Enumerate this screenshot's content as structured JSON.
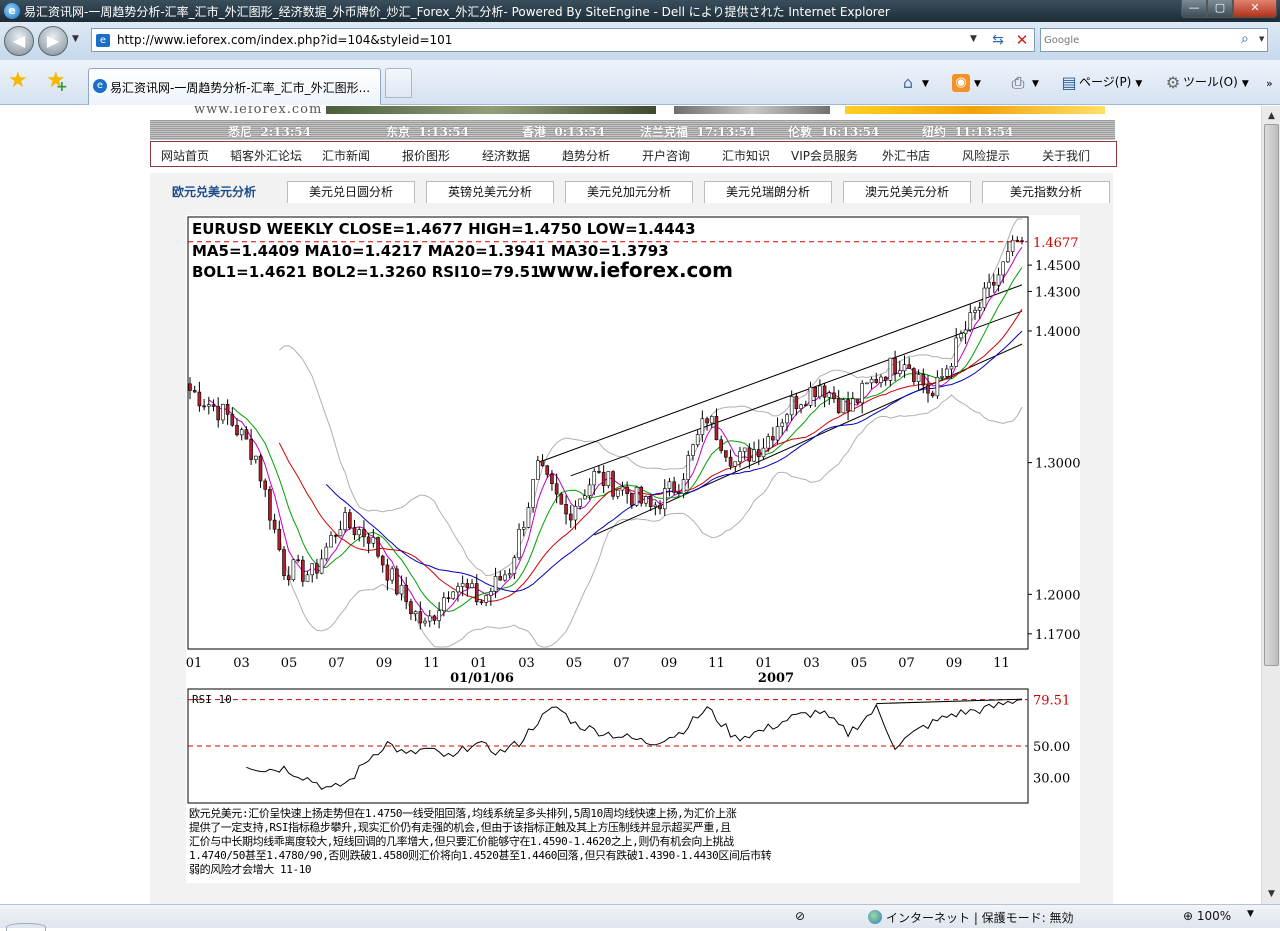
{
  "window": {
    "title": "易汇资讯网-一周趋势分析-汇率_汇市_外汇图形_经济数据_外币牌价_炒汇_Forex_外汇分析- Powered By SiteEngine - Dell により提供された Internet Explorer",
    "min_symbol": "—",
    "max_symbol": "▢",
    "close_symbol": "✕"
  },
  "address": {
    "url": "http://www.ieforex.com/index.php?id=104&styleid=101",
    "search_placeholder": "Google"
  },
  "tabs": [
    {
      "label": "易汇资讯网-一周趋势分析-汇率_汇市_外汇图形..."
    }
  ],
  "commands": {
    "page": "ページ(P)",
    "tools": "ツール(O)"
  },
  "site": {
    "logo_fragment": "www.ieforex.com",
    "clocks": [
      {
        "city": "悉尼",
        "time": "2:13:54"
      },
      {
        "city": "东京",
        "time": "1:13:54"
      },
      {
        "city": "香港",
        "time": "0:13:54"
      },
      {
        "city": "法兰克福",
        "time": "17:13:54"
      },
      {
        "city": "伦敦",
        "time": "16:13:54"
      },
      {
        "city": "纽约",
        "time": "11:13:54"
      }
    ],
    "nav": [
      "网站首页",
      "韬客外汇论坛",
      "汇市新闻",
      "报价图形",
      "经济数据",
      "趋势分析",
      "开户咨询",
      "汇市知识",
      "VIP会员服务",
      "外汇书店",
      "风险提示",
      "关于我们"
    ],
    "sub_tabs": [
      "欧元兑美元分析",
      "美元兑日圆分析",
      "英镑兑美元分析",
      "美元兑加元分析",
      "美元兑瑞朗分析",
      "澳元兑美元分析",
      "美元指数分析"
    ]
  },
  "chart_data": {
    "type": "candlestick",
    "info_line1": "EURUSD WEEKLY  CLOSE=1.4677   HIGH=1.4750   LOW=1.4443",
    "info_line2": "MA5=1.4409  MA10=1.4217  MA20=1.3941  MA30=1.3793",
    "info_line3": "BOL1=1.4621  BOL2=1.3260  RSI10=79.51",
    "watermark": "www.ieforex.com",
    "close_label": "1.4677",
    "y_ticks": [
      "1.4500",
      "1.4300",
      "1.4000",
      "1.3000",
      "1.2000",
      "1.1700"
    ],
    "y_tick_values": [
      1.45,
      1.43,
      1.4,
      1.3,
      1.2,
      1.17
    ],
    "ylim": [
      1.16,
      1.485
    ],
    "x_ticks": [
      "01",
      "03",
      "05",
      "07",
      "09",
      "11",
      "01",
      "03",
      "05",
      "07",
      "09",
      "11",
      "01",
      "03",
      "05",
      "07",
      "09",
      "11"
    ],
    "year_labels": [
      "01/01/06",
      "2007"
    ],
    "close": 1.4677,
    "high": 1.475,
    "low": 1.4443,
    "series_weekly_close_anchors": [
      [
        0,
        1.355
      ],
      [
        8,
        1.335
      ],
      [
        14,
        1.305
      ],
      [
        20,
        1.22
      ],
      [
        26,
        1.215
      ],
      [
        32,
        1.255
      ],
      [
        38,
        1.245
      ],
      [
        44,
        1.205
      ],
      [
        50,
        1.175
      ],
      [
        56,
        1.21
      ],
      [
        62,
        1.195
      ],
      [
        68,
        1.22
      ],
      [
        74,
        1.295
      ],
      [
        80,
        1.26
      ],
      [
        86,
        1.29
      ],
      [
        92,
        1.28
      ],
      [
        98,
        1.265
      ],
      [
        104,
        1.285
      ],
      [
        110,
        1.335
      ],
      [
        116,
        1.3
      ],
      [
        122,
        1.315
      ],
      [
        128,
        1.345
      ],
      [
        134,
        1.36
      ],
      [
        140,
        1.34
      ],
      [
        146,
        1.365
      ],
      [
        152,
        1.38
      ],
      [
        158,
        1.35
      ],
      [
        164,
        1.395
      ],
      [
        170,
        1.43
      ],
      [
        176,
        1.4677
      ]
    ],
    "rsi": {
      "label": "RSI 10",
      "value_label": "79.51",
      "levels": [
        "50.00",
        "30.00"
      ],
      "ylim": [
        15,
        85
      ],
      "series_anchors": [
        [
          12,
          38
        ],
        [
          16,
          35
        ],
        [
          20,
          36
        ],
        [
          26,
          28
        ],
        [
          30,
          22
        ],
        [
          34,
          28
        ],
        [
          38,
          42
        ],
        [
          42,
          52
        ],
        [
          46,
          44
        ],
        [
          50,
          48
        ],
        [
          56,
          42
        ],
        [
          60,
          52
        ],
        [
          66,
          46
        ],
        [
          70,
          52
        ],
        [
          74,
          66
        ],
        [
          78,
          75
        ],
        [
          82,
          64
        ],
        [
          86,
          60
        ],
        [
          92,
          56
        ],
        [
          98,
          52
        ],
        [
          104,
          58
        ],
        [
          110,
          74
        ],
        [
          116,
          55
        ],
        [
          122,
          60
        ],
        [
          128,
          68
        ],
        [
          134,
          72
        ],
        [
          140,
          58
        ],
        [
          146,
          74
        ],
        [
          150,
          50
        ],
        [
          156,
          62
        ],
        [
          162,
          70
        ],
        [
          170,
          74
        ],
        [
          176,
          79.51
        ]
      ]
    }
  },
  "commentary": [
    "欧元兑美元:汇价呈快速上扬走势但在1.4750一线受阻回落,均线系统呈多头排列,5周10周均线快速上扬,为汇价上涨",
    "提供了一定支持,RSI指标稳步攀升,现实汇价仍有走强的机会,但由于该指标正触及其上方压制线并显示超买严重,且",
    "汇价与中长期均线乖离度较大,短线回调的几率增大,但只要汇价能够守在1.4590-1.4620之上,则仍有机会向上挑战",
    "1.4740/50甚至1.4780/90,否则跌破1.4580则汇价将向1.4520甚至1.4460回落,但只有跌破1.4390-1.4430区间后市转",
    "弱的风险才会增大        11-10"
  ],
  "status": {
    "zone": "インターネット | 保護モード: 無効",
    "zoom": "100%"
  },
  "colors": {
    "candle_up": "#ffffff",
    "candle_down": "#b0202a",
    "ma5": "#c000c0",
    "ma10": "#00a000",
    "ma20": "#d00000",
    "ma30": "#0000c0",
    "bollinger": "#b0b0b0",
    "close_line": "#d00000"
  }
}
